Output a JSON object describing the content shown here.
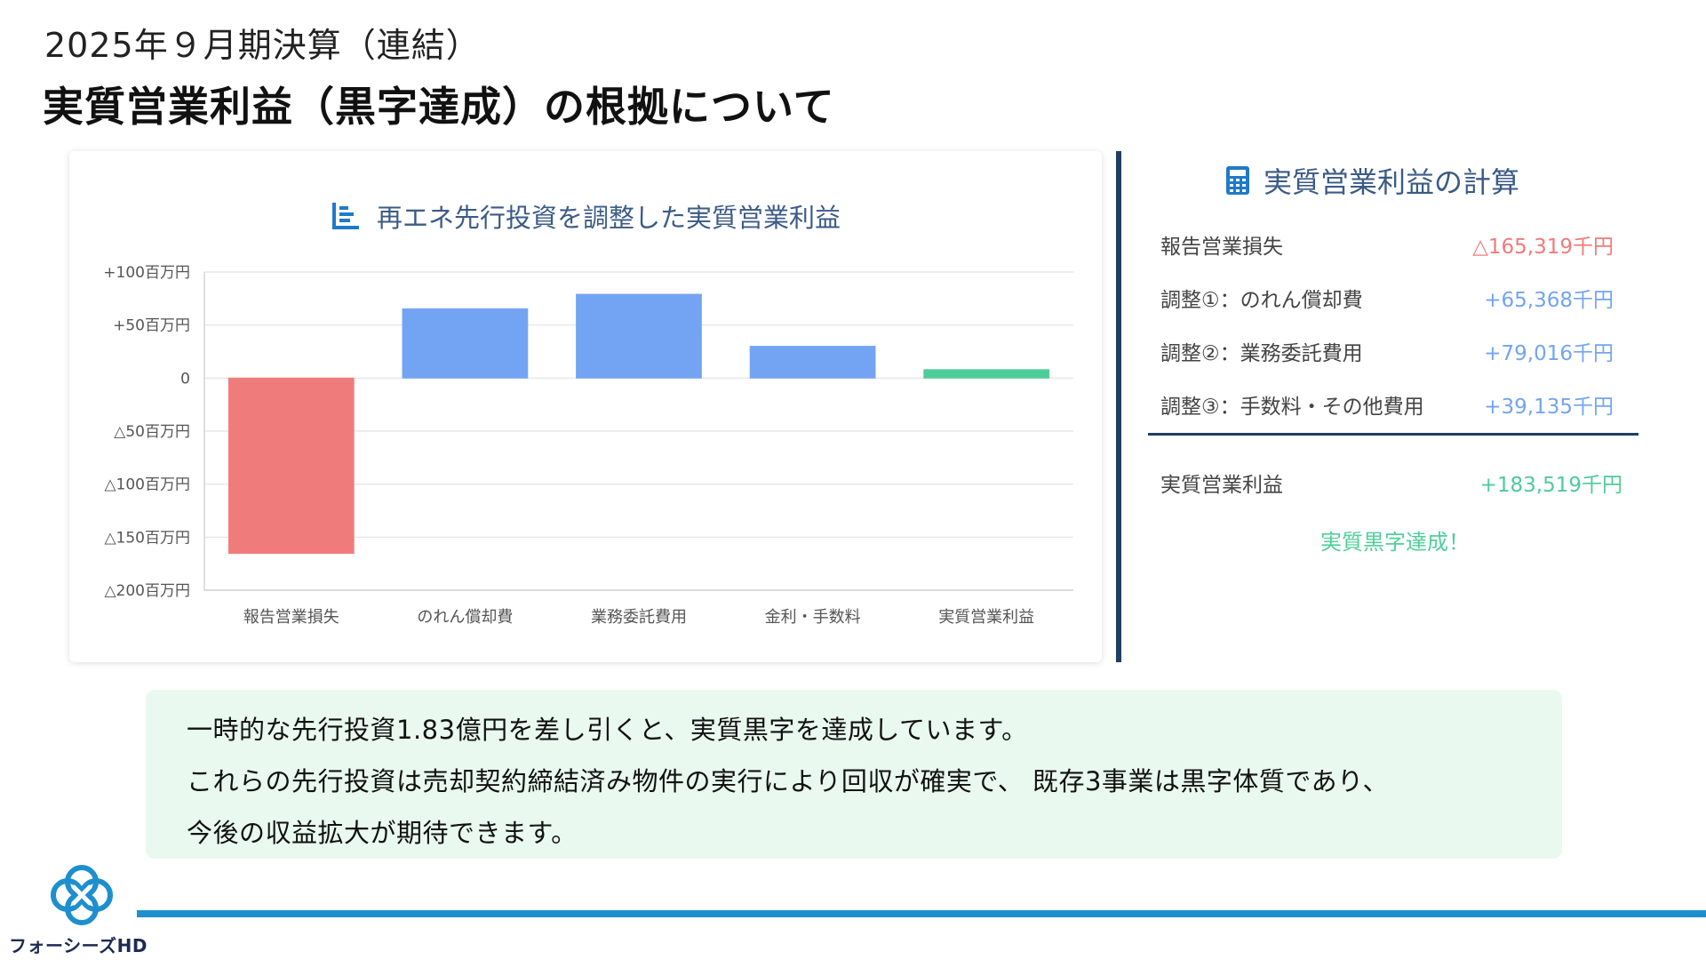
{
  "header": {
    "subtitle": "2025年９月期決算（連結）",
    "title": "実質営業利益（黒字達成）の根拠について"
  },
  "chart_heading": {
    "icon": "bar-chart-icon",
    "text": "再エネ先行投資を調整した実質営業利益"
  },
  "chart_data": {
    "type": "bar",
    "title": "再エネ先行投資を調整した実質営業利益",
    "categories": [
      "報告営業損失",
      "のれん償却費",
      "業務委託費用",
      "金利・手数料",
      "実質営業利益"
    ],
    "series": [
      {
        "values": [
          -165.319,
          65.368,
          79.016,
          30,
          8
        ],
        "colors": [
          "#f07b7b",
          "#73a4f3",
          "#73a4f3",
          "#73a4f3",
          "#4ecc99"
        ]
      }
    ],
    "ylim": [
      -200,
      100
    ],
    "yticks": [
      100,
      50,
      0,
      -50,
      -100,
      -150,
      -200
    ],
    "ytick_labels": [
      "+100百万円",
      "+50百万円",
      "0",
      "△50百万円",
      "△100百万円",
      "△150百万円",
      "△200百万円"
    ],
    "grid": true,
    "xlabel": "",
    "ylabel": ""
  },
  "calc": {
    "icon": "calculator-icon",
    "heading": "実質営業利益の計算",
    "rows": [
      {
        "label": "報告営業損失",
        "value": "△165,319千円",
        "color": "#f07b7b"
      },
      {
        "label": "調整①：のれん償却費",
        "value": "+65,368千円",
        "color": "#73a4f3"
      },
      {
        "label": "調整②：業務委託費用",
        "value": "+79,016千円",
        "color": "#73a4f3"
      },
      {
        "label": "調整③：手数料・その他費用",
        "value": "+39,135千円",
        "color": "#73a4f3"
      }
    ],
    "total": {
      "label": "実質営業利益",
      "value": "+183,519千円",
      "color": "#4ecc99"
    },
    "achieved": "実質黒字達成！"
  },
  "note": {
    "lines": [
      "一時的な先行投資1.83億円を差し引くと、実質黒字を達成しています。",
      "これらの先行投資は売却契約締結済み物件の実行により回収が確実で、 既存3事業は黒字体質であり、",
      "今後の収益拡大が期待できます。"
    ]
  },
  "footer": {
    "logo_icon": "company-logo-icon",
    "company": "フォーシーズHD"
  }
}
